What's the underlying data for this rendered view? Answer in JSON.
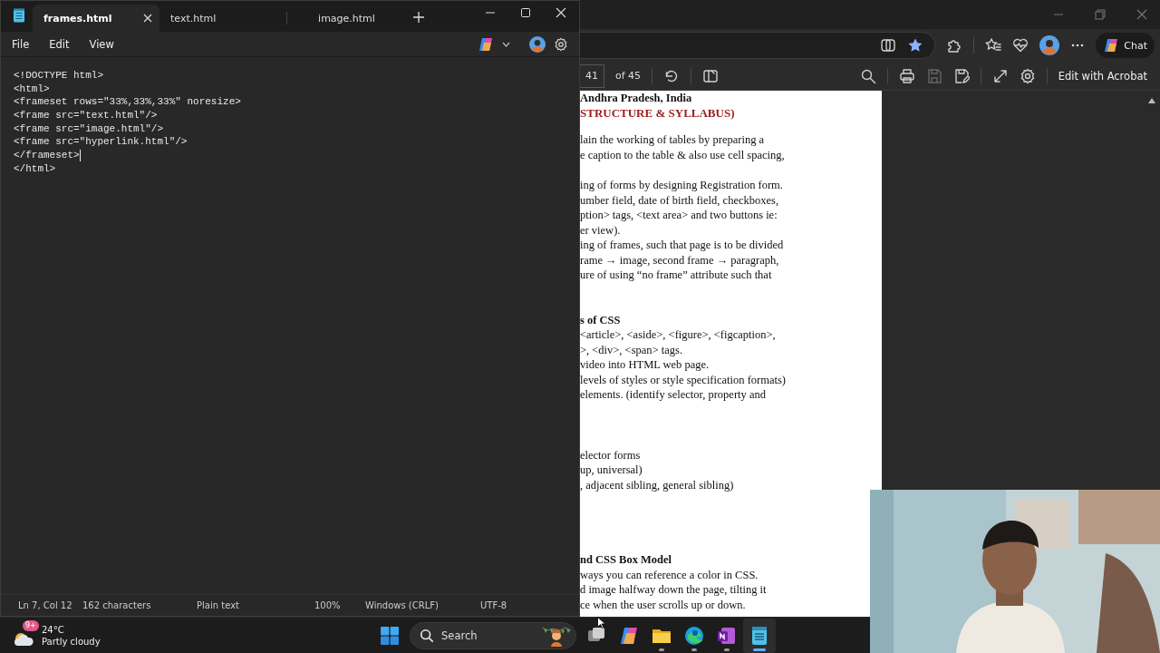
{
  "notepad": {
    "tabs": [
      {
        "label": "frames.html",
        "selected": true
      },
      {
        "label": "text.html",
        "selected": false
      },
      {
        "label": "image.html",
        "selected": false
      }
    ],
    "menu": [
      "File",
      "Edit",
      "View"
    ],
    "code_lines": [
      {
        "text": "<!DOCTYPE html>",
        "cursor": false
      },
      {
        "text": "<html>",
        "cursor": false
      },
      {
        "text": "<frameset rows=\"33%,33%,33%\" noresize>",
        "cursor": false
      },
      {
        "text": "<frame src=\"text.html\"/>",
        "cursor": false
      },
      {
        "text": "<frame src=\"image.html\"/>",
        "cursor": false
      },
      {
        "text": "<frame src=\"hyperlink.html\"/>",
        "cursor": false
      },
      {
        "text": "</frameset>",
        "cursor": true
      },
      {
        "text": "</html>",
        "cursor": false
      }
    ],
    "status_bar": [
      "Ln 7, Col 12",
      "162 characters",
      "Plain text",
      "100%",
      "Windows (CRLF)",
      "UTF-8"
    ]
  },
  "browser": {
    "chat_button": "Chat",
    "pdf_toolbar": {
      "page": "41",
      "page_count": "of 45",
      "edit_button": "Edit with Acrobat"
    },
    "document": {
      "blocks": [
        {
          "kind": "heading",
          "lines": [
            "Andhra Pradesh, India"
          ]
        },
        {
          "kind": "subtitle",
          "lines": [
            "STRUCTURE & SYLLABUS)"
          ]
        },
        {
          "kind": "text",
          "lines": [
            "lain the working of tables by preparing a",
            "e caption to the table & also use cell spacing,"
          ]
        },
        {
          "kind": "text",
          "lines": [
            "ing of forms by designing Registration form.",
            "umber field, date of birth field, checkboxes,",
            "ption> tags, <text area> and two buttons ie:",
            "er view).",
            "ing of frames, such that page is to be divided",
            "rame  → image, second frame  → paragraph,",
            "ure of using “no frame” attribute such that"
          ]
        },
        {
          "kind": "heading",
          "lines": [
            "s of CSS"
          ]
        },
        {
          "kind": "text",
          "lines": [
            "<article>, <aside>, <figure>, <figcaption>,",
            ">, <div>, <span> tags.",
            "video into HTML web page.",
            "levels of styles or style specification formats)",
            "elements. (identify selector, property and"
          ]
        },
        {
          "kind": "text",
          "lines": [
            "elector forms",
            "up, universal)",
            ", adjacent sibling,  general sibling)"
          ]
        },
        {
          "kind": "heading",
          "lines": [
            "nd CSS Box Model"
          ]
        },
        {
          "kind": "text",
          "lines": [
            "ways you can reference a color in CSS.",
            "d image halfway down the page, tilting it",
            "ce when the user scrolls up or down."
          ]
        }
      ]
    }
  },
  "taskbar": {
    "weather": {
      "badge": "9+",
      "temperature": "24°C",
      "condition": "Partly cloudy"
    },
    "search_label": "Search",
    "apps": [
      {
        "kind": "taskview",
        "running": false,
        "active": false
      },
      {
        "kind": "copilot",
        "running": false,
        "active": false
      },
      {
        "kind": "folder",
        "running": true,
        "active": false
      },
      {
        "kind": "edge",
        "running": true,
        "active": false
      },
      {
        "kind": "onenote",
        "running": true,
        "active": false
      },
      {
        "kind": "notepad",
        "running": true,
        "active": true
      }
    ]
  }
}
